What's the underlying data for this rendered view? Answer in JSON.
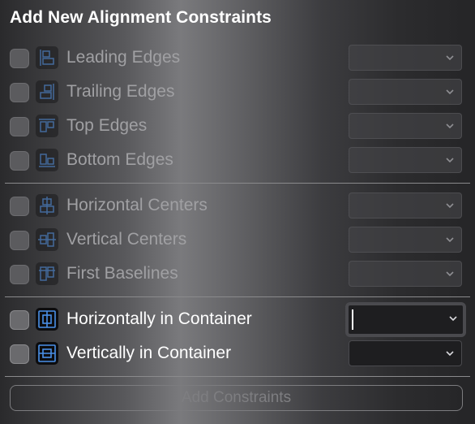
{
  "title": "Add New Alignment Constraints",
  "rows": [
    {
      "label": "Leading Edges",
      "icon": "leading-edges-icon",
      "checked": false,
      "enabled": false
    },
    {
      "label": "Trailing Edges",
      "icon": "trailing-edges-icon",
      "checked": false,
      "enabled": false
    },
    {
      "label": "Top Edges",
      "icon": "top-edges-icon",
      "checked": false,
      "enabled": false
    },
    {
      "label": "Bottom Edges",
      "icon": "bottom-edges-icon",
      "checked": false,
      "enabled": false
    },
    {
      "label": "Horizontal Centers",
      "icon": "horizontal-centers-icon",
      "checked": false,
      "enabled": false
    },
    {
      "label": "Vertical Centers",
      "icon": "vertical-centers-icon",
      "checked": false,
      "enabled": false
    },
    {
      "label": "First Baselines",
      "icon": "first-baselines-icon",
      "checked": false,
      "enabled": false
    },
    {
      "label": "Horizontally in Container",
      "icon": "horizontally-in-container-icon",
      "checked": false,
      "enabled": true,
      "focused": true
    },
    {
      "label": "Vertically in Container",
      "icon": "vertically-in-container-icon",
      "checked": false,
      "enabled": true
    }
  ],
  "add_button": "Add Constraints",
  "colors": {
    "icon_stroke": "#4a90e8",
    "focus_ring": "#a06e9e"
  }
}
